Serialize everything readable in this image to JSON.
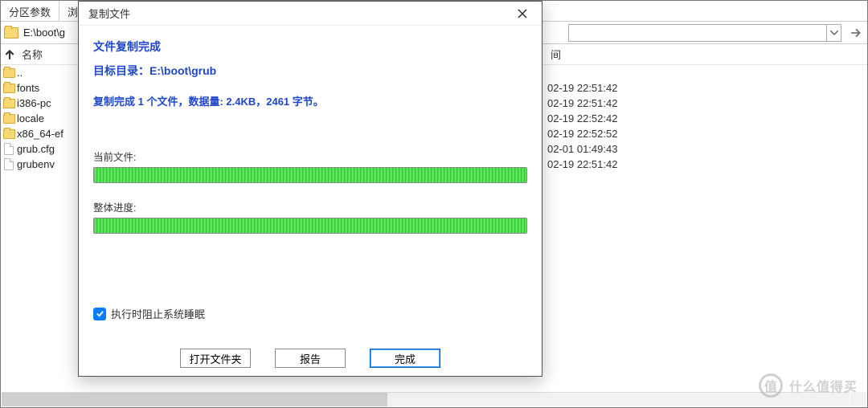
{
  "tabs": [
    "分区参数",
    "浏"
  ],
  "path_value": "E:\\boot\\g",
  "columns": {
    "name": "名称",
    "time": "间"
  },
  "files": [
    {
      "name": "..",
      "type": "folder",
      "time": ""
    },
    {
      "name": "fonts",
      "type": "folder",
      "time": "02-19 22:51:42"
    },
    {
      "name": "i386-pc",
      "type": "folder",
      "time": "02-19 22:51:42"
    },
    {
      "name": "locale",
      "type": "folder",
      "time": "02-19 22:52:42"
    },
    {
      "name": "x86_64-ef",
      "type": "folder",
      "time": "02-19 22:52:52"
    },
    {
      "name": "grub.cfg",
      "type": "file",
      "time": "02-01 01:49:43"
    },
    {
      "name": "grubenv",
      "type": "file",
      "time": "02-19 22:51:42"
    }
  ],
  "modal": {
    "title": "复制文件",
    "headline": "文件复制完成",
    "target_label": "目标目录：E:\\boot\\grub",
    "stats": "复制完成 1 个文件，数据量: 2.4KB，2461 字节。",
    "current_label": "当前文件:",
    "overall_label": "整体进度:",
    "progress_current_pct": 100,
    "progress_overall_pct": 100,
    "checkbox_label": "执行时阻止系统睡眠",
    "checkbox_checked": true,
    "buttons": {
      "open": "打开文件夹",
      "report": "报告",
      "done": "完成"
    }
  },
  "watermark": {
    "badge": "值",
    "text": "什么值得买"
  }
}
